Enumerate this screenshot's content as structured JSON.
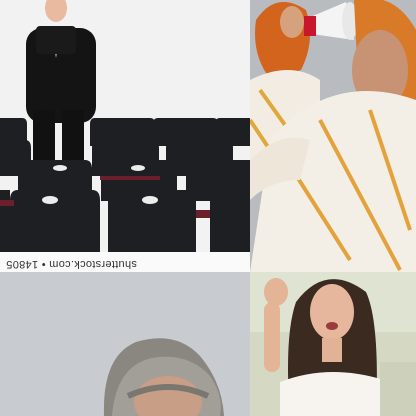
{
  "tiles": [
    {
      "scene": "man-with-megaphone-in-auditorium",
      "watermark": "shutterstock.com • 14805",
      "bg": "#f4f4f4"
    },
    {
      "scene": "women-in-hijab-with-megaphone",
      "bg": "#b9bcc0"
    },
    {
      "scene": "older-woman-portrait",
      "bg": "#c9cdd2"
    },
    {
      "scene": "young-woman-shouting",
      "bg": "#d7dac6"
    }
  ]
}
